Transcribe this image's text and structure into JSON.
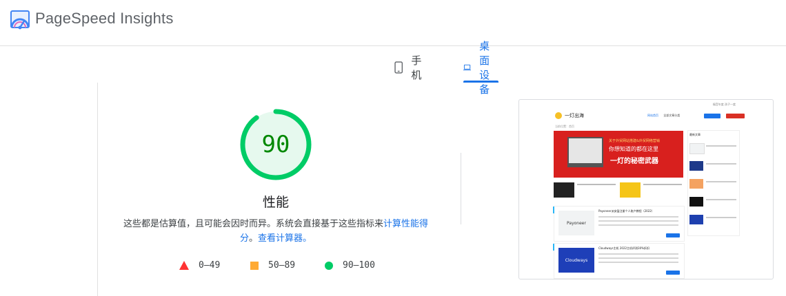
{
  "header": {
    "brand": "PageSpeed Insights",
    "logo_icon": "pagespeed-logo-icon"
  },
  "tabs": [
    {
      "label": "手机",
      "icon": "phone-icon",
      "selected": false
    },
    {
      "label": "桌面设备",
      "icon": "laptop-icon",
      "selected": true
    }
  ],
  "score": {
    "value": "90",
    "fraction": 0.9,
    "color": "#00cc66",
    "text_color": "#008800"
  },
  "category": {
    "title": "性能"
  },
  "description": {
    "text": "这些都是估算值，且可能会因时而异。系统会直接基于这些指标来",
    "link1": "计算性能得分",
    "sep": "。",
    "link2": "查看计算器。"
  },
  "legend": [
    {
      "range": "0–49",
      "shape": "triangle",
      "color": "#ff3333"
    },
    {
      "range": "50–89",
      "shape": "square",
      "color": "#ffaa33"
    },
    {
      "range": "90–100",
      "shape": "circle",
      "color": "#00cc66"
    }
  ],
  "screenshot": {
    "site_name": "一灯出海",
    "top_links": "福音年度  孩子一度",
    "nav": [
      "网站首页",
      "全部文章分类"
    ],
    "breadcrumb": "当前位置：首页",
    "banner_line1": "关于外贸网站搭建&外贸网络营销",
    "banner_line2": "你想知道的都在这里",
    "banner_line3": "一灯的秘密武器",
    "sidebar_title": "最新文章",
    "card1_title": "Payoneer派安盈注册个人账户教程（2022）",
    "card1_logo": "Payoneer",
    "card2_title": "Cloudways主机 2022主机评测30%折扣",
    "card2_logo": "Cloudways"
  }
}
